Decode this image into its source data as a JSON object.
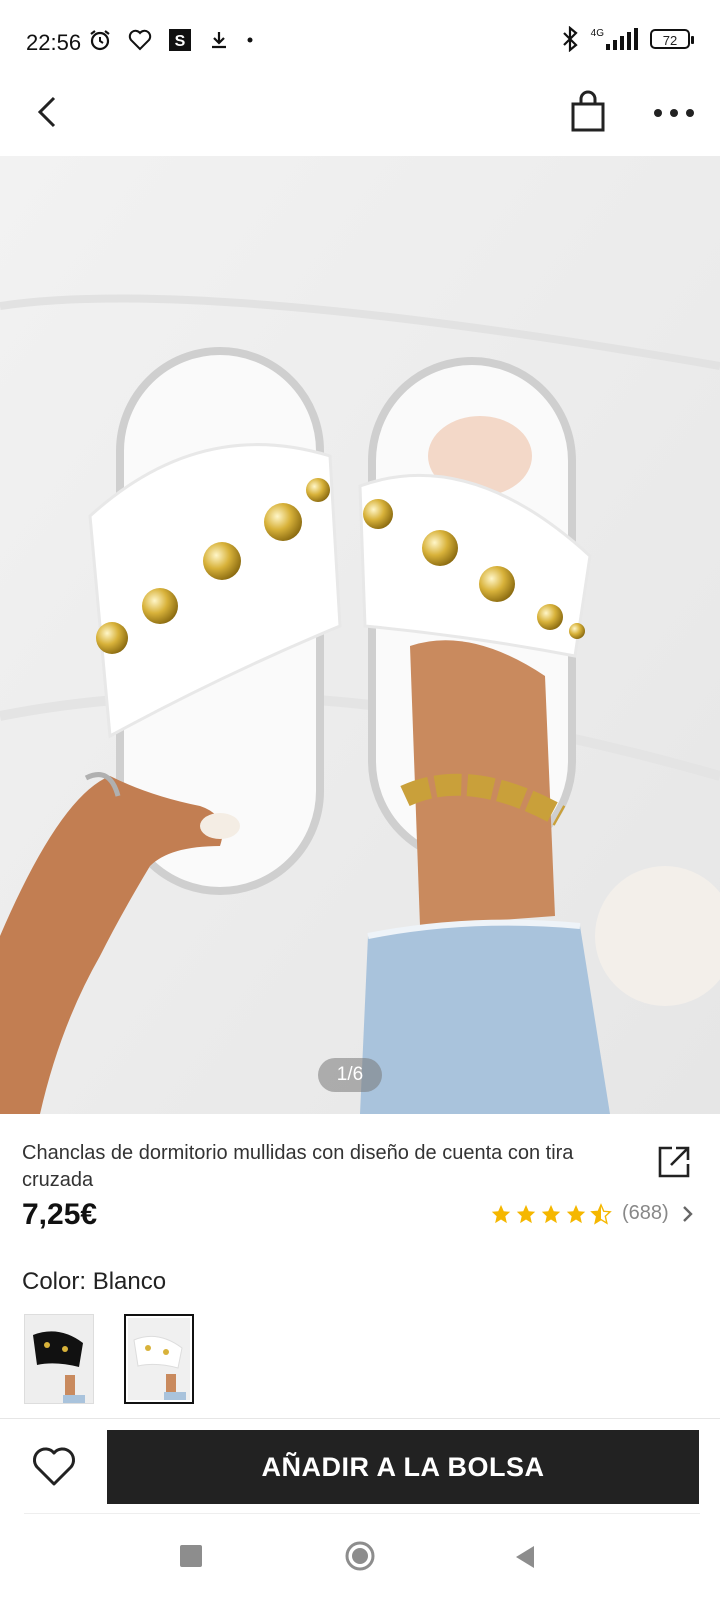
{
  "status_bar": {
    "time": "22:56",
    "network": "4G",
    "battery": "72"
  },
  "nav": {
    "back_icon": "chevron-left-icon",
    "bag_icon": "shopping-bag-icon",
    "more_icon": "more-dots-icon"
  },
  "gallery": {
    "counter": "1/6",
    "current": 1,
    "total": 6
  },
  "product": {
    "title": "Chanclas de dormitorio mullidas con diseño de cuenta con tira cruzada",
    "price": "7,25€",
    "rating": 4.5,
    "rating_count": "(688)",
    "star_color": "#f5b700"
  },
  "color": {
    "label": "Color: Blanco",
    "options": [
      "black",
      "white"
    ],
    "selected": "white"
  },
  "actions": {
    "add_to_bag": "AÑADIR A LA BOLSA",
    "wishlist_icon": "heart-icon"
  },
  "colors": {
    "button_bg": "#222222",
    "button_text": "#ffffff"
  }
}
